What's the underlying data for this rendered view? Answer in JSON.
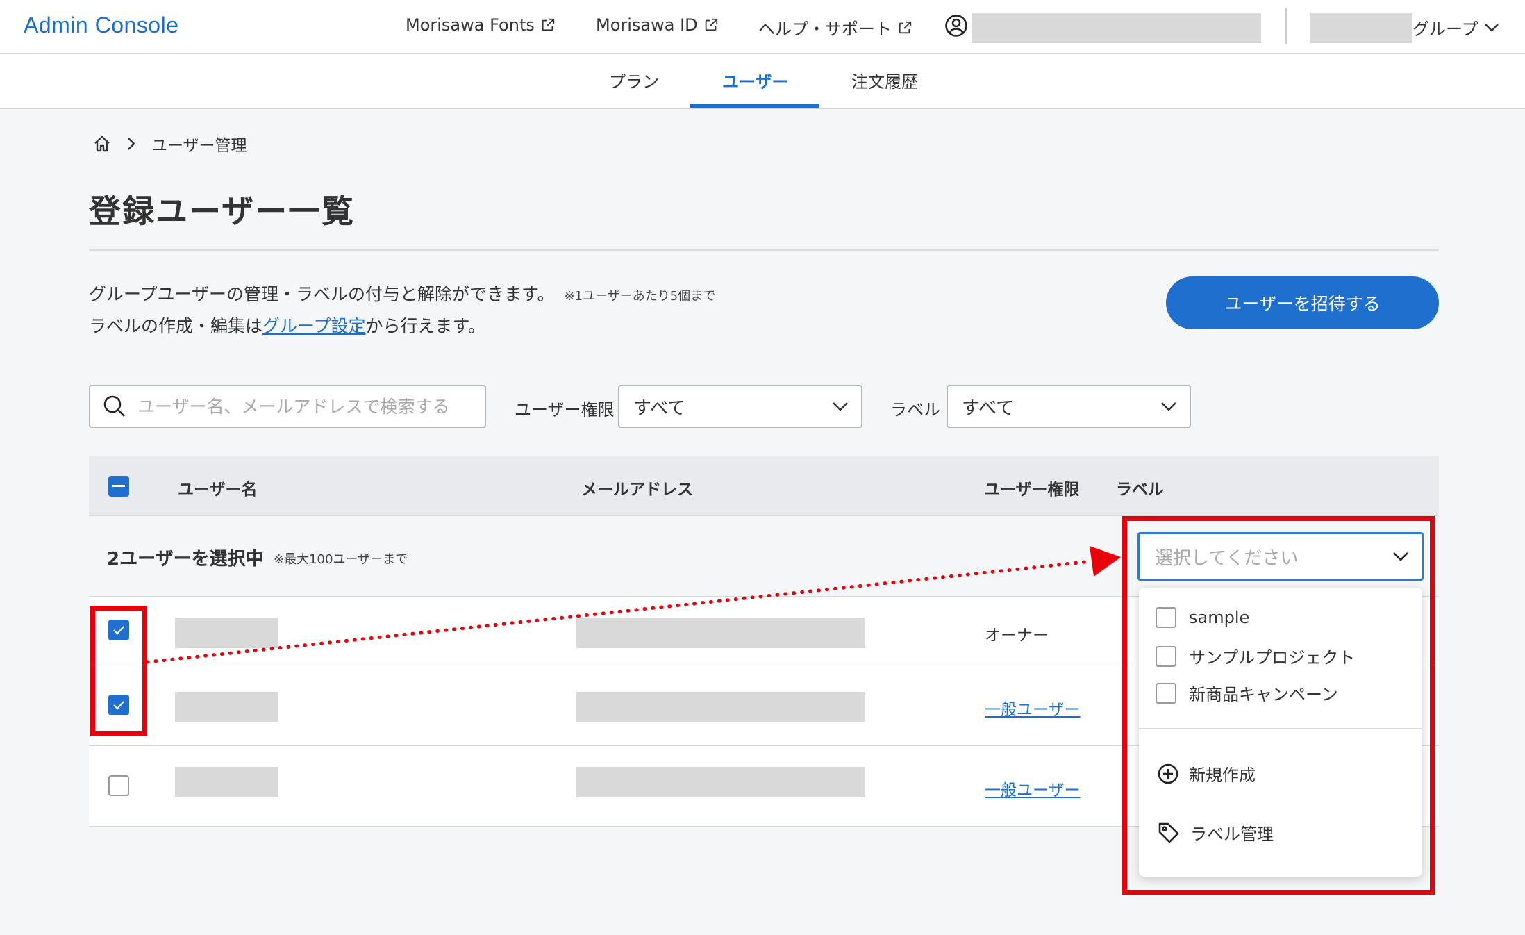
{
  "header": {
    "app_title": "Admin Console",
    "links": [
      "Morisawa Fonts",
      "Morisawa ID",
      "ヘルプ・サポート"
    ],
    "group_label": "グループ"
  },
  "nav": {
    "tabs": [
      "プラン",
      "ユーザー",
      "注文履歴"
    ],
    "active_tab": "ユーザー"
  },
  "breadcrumb": {
    "current": "ユーザー管理"
  },
  "page": {
    "title": "登録ユーザー一覧",
    "description_line1": "グループユーザーの管理・ラベルの付与と解除ができます。",
    "description_note": "※1ユーザーあたり5個まで",
    "description_line2_prefix": "ラベルの作成・編集は",
    "description_link": "グループ設定",
    "description_line2_suffix": "から行えます。",
    "invite_button": "ユーザーを招待する"
  },
  "filters": {
    "search_placeholder": "ユーザー名、メールアドレスで検索する",
    "role_label": "ユーザー権限",
    "role_value": "すべて",
    "label_label": "ラベル",
    "label_value": "すべて"
  },
  "table": {
    "columns": [
      "ユーザー名",
      "メールアドレス",
      "ユーザー権限",
      "ラベル"
    ],
    "selection": {
      "count_text": "2ユーザーを選択中",
      "note": "※最大100ユーザーまで"
    },
    "rows": [
      {
        "checked": true,
        "role": "オーナー",
        "role_is_link": false
      },
      {
        "checked": true,
        "role": "一般ユーザー",
        "role_is_link": true
      },
      {
        "checked": false,
        "role": "一般ユーザー",
        "role_is_link": true
      }
    ]
  },
  "label_dropdown": {
    "placeholder": "選択してください",
    "options": [
      "sample",
      "サンプルプロジェクト",
      "新商品キャンペーン"
    ],
    "actions": {
      "create": "新規作成",
      "manage": "ラベル管理"
    }
  },
  "colors": {
    "accent": "#1a6fcf",
    "annotation": "#e8000b",
    "masked": "#d9d9d9"
  }
}
